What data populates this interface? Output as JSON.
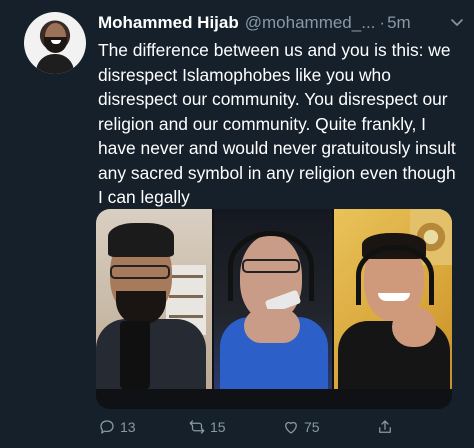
{
  "tweet": {
    "author_name": "Mohammed Hijab",
    "handle": "@mohammed_...",
    "separator": "·",
    "time": "5m",
    "text": "The difference between us and you is this: we disrespect Islamophobes like you who disrespect our community. You disrespect our religion and our community. Quite frankly, I have never and would never gratuitously insult any sacred symbol in any religion even though I can legally"
  },
  "actions": {
    "reply_count": "13",
    "retweet_count": "15",
    "like_count": "75",
    "icons": [
      "reply-icon",
      "retweet-icon",
      "like-icon",
      "share-icon"
    ]
  },
  "colors": {
    "background": "#15202b",
    "secondary_text": "#8899a6",
    "primary_text": "#ffffff"
  }
}
